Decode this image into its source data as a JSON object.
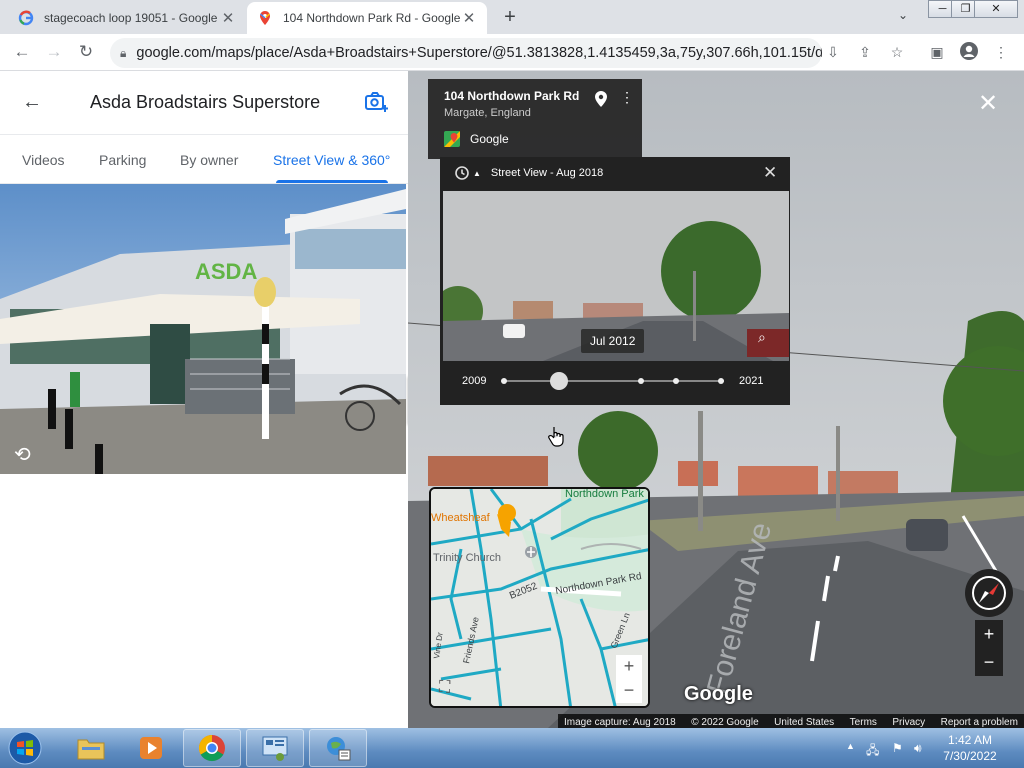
{
  "browser": {
    "tabs": [
      {
        "title": "stagecoach loop 19051 - Google",
        "icon": "google-g-icon"
      },
      {
        "title": "104 Northdown Park Rd - Google",
        "icon": "google-maps-pin-icon",
        "active": true
      }
    ],
    "url": "google.com/maps/place/Asda+Broadstairs+Superstore/@51.3813828,1.4135459,3a,75y,307.66h,101.15t/da..."
  },
  "place_panel": {
    "title": "Asda Broadstairs Superstore",
    "tabs": [
      "Videos",
      "Parking",
      "By owner",
      "Street View & 360°"
    ],
    "selected_tab": "Street View & 360°"
  },
  "street_view": {
    "address_title": "104 Northdown Park Rd",
    "address_sub": "Margate, England",
    "brand": "Google",
    "time_machine": {
      "header": "Street View - Aug 2018",
      "preview_date": "Jul 2012",
      "year_start": "2009",
      "year_end": "2021",
      "slider_fraction": 0.25
    },
    "minimap": {
      "labels": {
        "area": "Northdown Park",
        "place": "Wheatsheaf",
        "church": "Trinity Church",
        "road": "B2052",
        "street": "Northdown Park Rd",
        "lane": "Green Ln",
        "ave": "Friends Ave",
        "dr": "Vine Dr"
      }
    },
    "road_label": "Foreland Ave",
    "logo": "Google",
    "footer": [
      "Image capture: Aug 2018",
      "© 2022 Google",
      "United States",
      "Terms",
      "Privacy",
      "Report a problem"
    ]
  },
  "taskbar": {
    "time": "1:42 AM",
    "date": "7/30/2022"
  },
  "colors": {
    "accent": "#1a73e8",
    "road": "#1fa9c4",
    "taskbar": "#5d8bc0"
  }
}
